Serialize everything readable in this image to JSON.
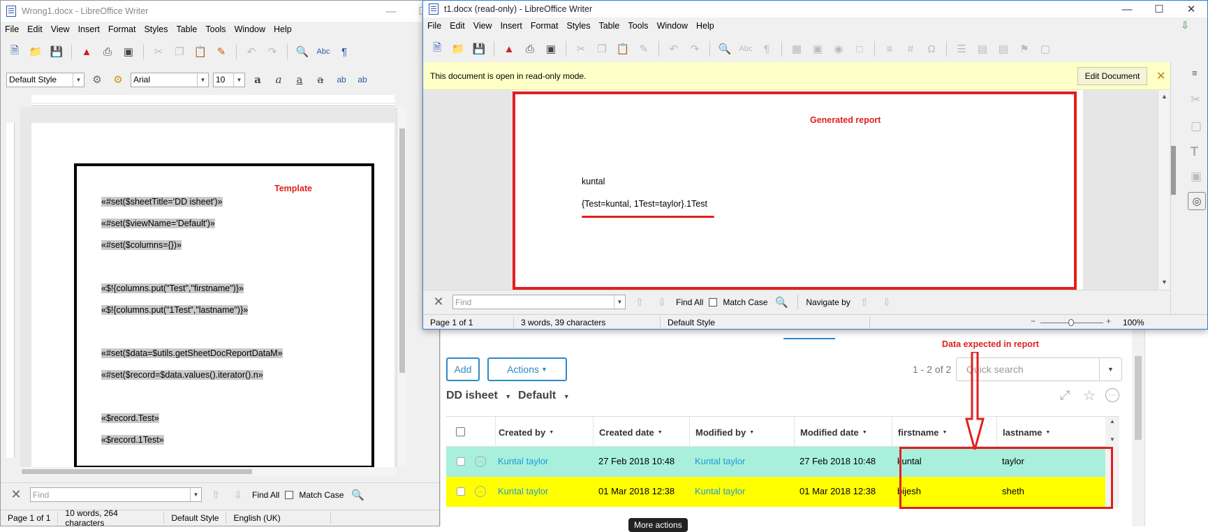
{
  "left_window": {
    "title": "Wrong1.docx - LibreOffice Writer",
    "menu": [
      "File",
      "Edit",
      "View",
      "Insert",
      "Format",
      "Styles",
      "Table",
      "Tools",
      "Window",
      "Help"
    ],
    "paragraph_style": "Default Style",
    "font_name": "Arial",
    "font_size": "10",
    "template_annotation": "Template",
    "template_lines": [
      "«#set($sheetTitle='DD isheet')»",
      "«#set($viewName='Default')»",
      "«#set($columns={})»",
      "",
      "«$!{columns.put(\"Test\",\"firstname\")}»",
      "«$!{columns.put(\"1Test\",\"lastname\")}»",
      "",
      "«#set($data=$utils.getSheetDocReportDataM»",
      "«#set($record=$data.values().iterator().n»",
      "",
      "«$record.Test»",
      "«$record.1Test»"
    ],
    "find_placeholder": "Find",
    "find_all": "Find All",
    "match_case": "Match Case",
    "status": {
      "page": "Page 1 of 1",
      "words": "10 words, 264 characters",
      "style": "Default Style",
      "language": "English (UK)"
    }
  },
  "right_window": {
    "title": "t1.docx (read-only) - LibreOffice Writer",
    "menu": [
      "File",
      "Edit",
      "View",
      "Insert",
      "Format",
      "Styles",
      "Table",
      "Tools",
      "Window",
      "Help"
    ],
    "infobar_text": "This document is open in read-only mode.",
    "edit_document_label": "Edit Document",
    "report_annotation": "Generated report",
    "doc_line1": "kuntal",
    "doc_line2": "{Test=kuntal, 1Test=taylor}.1Test",
    "find_placeholder": "Find",
    "find_all": "Find All",
    "match_case": "Match Case",
    "navigate_by": "Navigate by",
    "status": {
      "page": "Page 1 of 1",
      "words": "3 words, 39 characters",
      "style": "Default Style",
      "zoom": "100%"
    }
  },
  "webapp": {
    "add_label": "Add",
    "actions_label": "Actions",
    "pagination": "1 - 2 of 2",
    "search_placeholder": "Quick search",
    "expected_annotation": "Data expected in report",
    "sheet_name": "DD isheet",
    "view_name": "Default",
    "columns": [
      "Created by",
      "Created date",
      "Modified by",
      "Modified date",
      "firstname",
      "lastname"
    ],
    "rows": [
      {
        "created_by": "Kuntal taylor",
        "created_date": "27 Feb 2018 10:48",
        "modified_by": "Kuntal taylor",
        "modified_date": "27 Feb 2018 10:48",
        "firstname": "kuntal",
        "lastname": "taylor",
        "color": "#a8f0dc"
      },
      {
        "created_by": "Kuntal taylor",
        "created_date": "01 Mar 2018 12:38",
        "modified_by": "Kuntal taylor",
        "modified_date": "01 Mar 2018 12:38",
        "firstname": "bijesh",
        "lastname": "sheth",
        "color": "#ffff00"
      }
    ],
    "tooltip": "More actions"
  },
  "colors": {
    "annotation_red": "#e02020",
    "link_blue": "#1e9ad6",
    "infobar_yellow": "#ffffc8"
  },
  "icons": [
    "pdf-icon",
    "print-icon",
    "save-icon",
    "find-replace-icon",
    "spellcheck-icon",
    "close-icon",
    "expand-icon",
    "star-icon",
    "more-icon",
    "arrow-down-icon"
  ]
}
